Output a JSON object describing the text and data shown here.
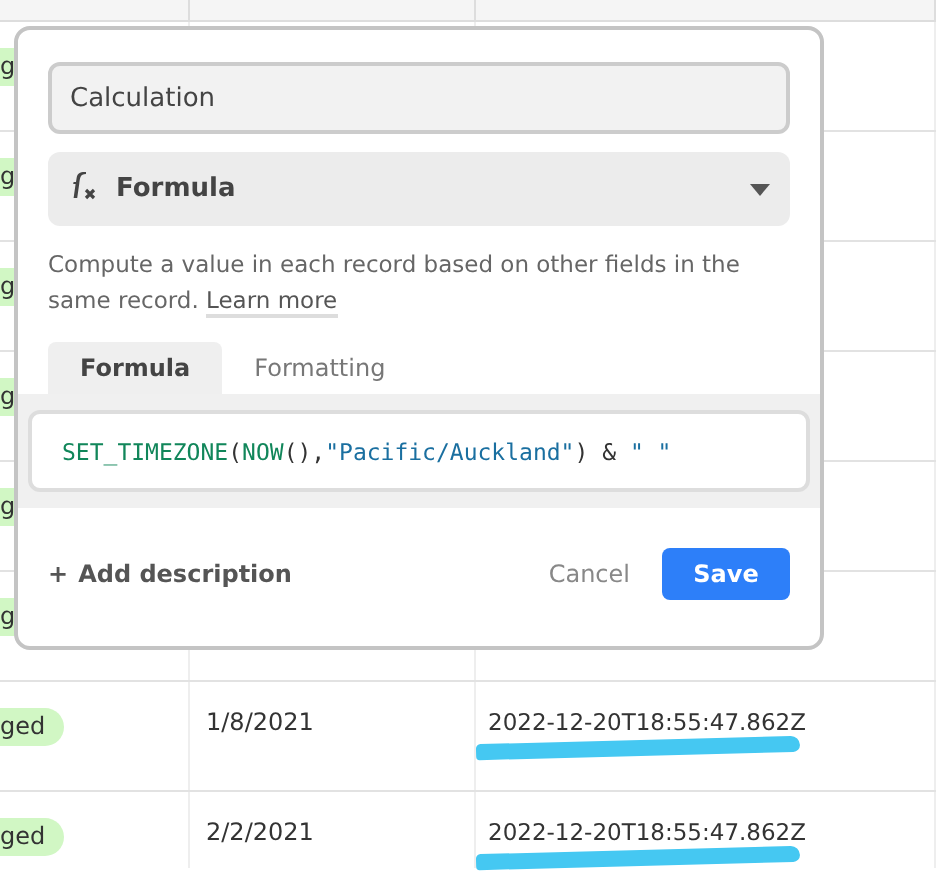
{
  "table": {
    "rows": [
      {
        "status": "g",
        "date": "",
        "calculation": ""
      },
      {
        "status": "g",
        "date": "",
        "calculation": ""
      },
      {
        "status": "g",
        "date": "",
        "calculation": ""
      },
      {
        "status": "g",
        "date": "",
        "calculation": ""
      },
      {
        "status": "g",
        "date": "",
        "calculation": ""
      },
      {
        "status": "g",
        "date": "",
        "calculation": ""
      },
      {
        "status": "ged",
        "date": "1/8/2021",
        "calculation": "2022-12-20T18:55:47.862Z"
      },
      {
        "status": "ged",
        "date": "2/2/2021",
        "calculation": "2022-12-20T18:55:47.862Z"
      }
    ]
  },
  "popover": {
    "field_name": "Calculation",
    "field_type": "Formula",
    "description": "Compute a value in each record based on other fields in the same record.",
    "learn_more": "Learn more",
    "tabs": [
      {
        "label": "Formula",
        "selected": true
      },
      {
        "label": "Formatting",
        "selected": false
      }
    ],
    "formula": [
      {
        "kind": "func",
        "text": "SET_TIMEZONE"
      },
      {
        "kind": "punct",
        "text": "("
      },
      {
        "kind": "func",
        "text": "NOW"
      },
      {
        "kind": "punct",
        "text": "(),"
      },
      {
        "kind": "string",
        "text": "\"Pacific/Auckland\""
      },
      {
        "kind": "punct",
        "text": ")"
      },
      {
        "kind": "op",
        "text": " & "
      },
      {
        "kind": "string",
        "text": "\" \""
      }
    ],
    "add_description": "Add description",
    "add_icon": "+",
    "cancel": "Cancel",
    "save": "Save"
  }
}
